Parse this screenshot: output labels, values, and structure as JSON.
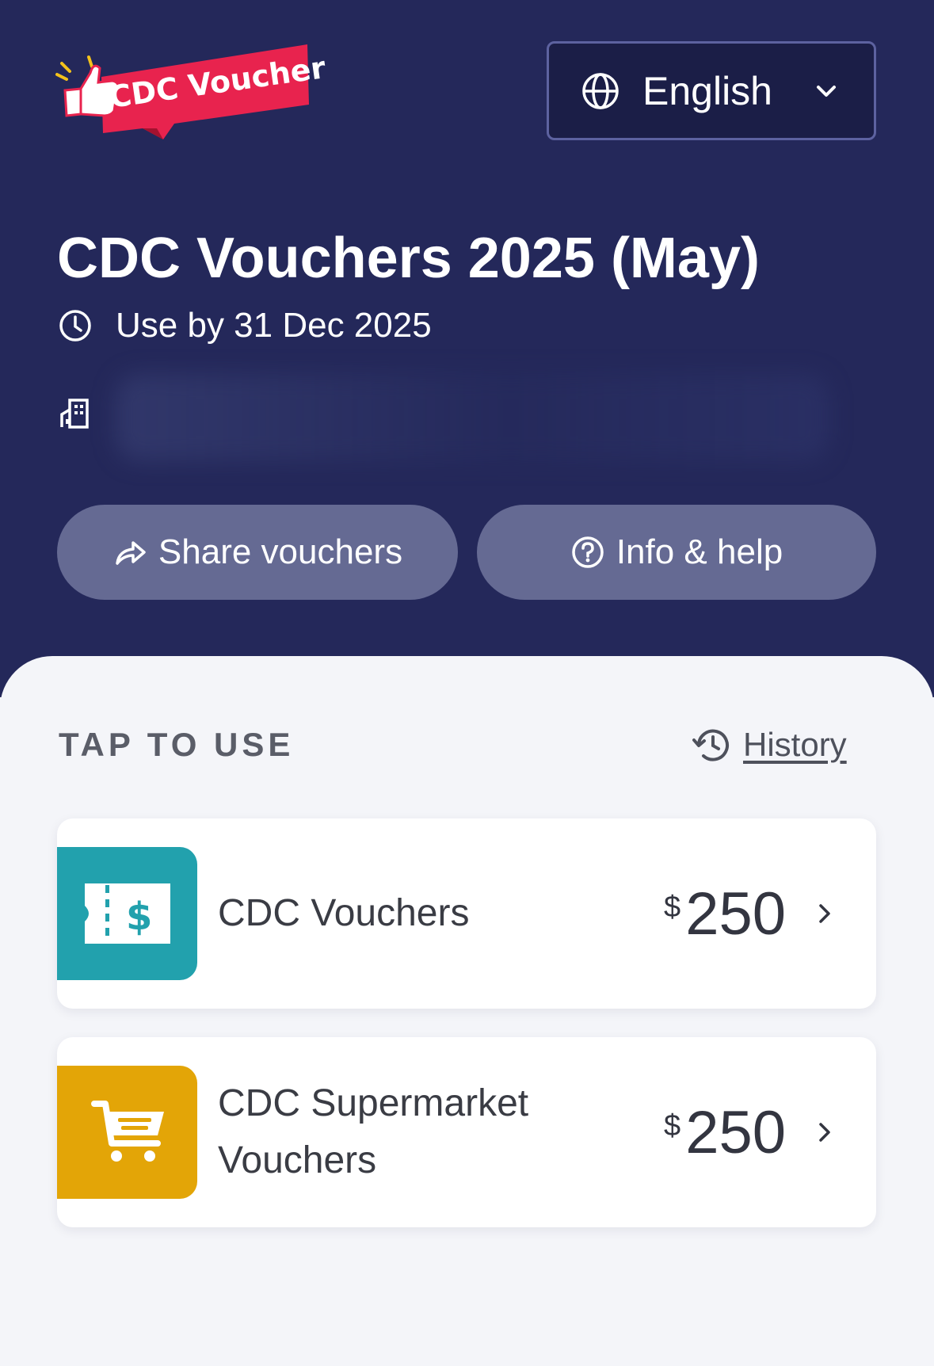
{
  "header": {
    "logo_text": "CDC Voucher",
    "language": {
      "selected": "English"
    },
    "title": "CDC Vouchers 2025 (May)",
    "expiry": "Use by 31 Dec 2025",
    "share_label": "Share vouchers",
    "info_label": "Info & help"
  },
  "main": {
    "section_label": "TAP TO USE",
    "history_label": "History",
    "vouchers": [
      {
        "name": "CDC Vouchers",
        "currency": "$",
        "amount": "250",
        "icon": "ticket-dollar-icon"
      },
      {
        "name": "CDC Supermarket Vouchers",
        "currency": "$",
        "amount": "250",
        "icon": "shopping-cart-icon"
      }
    ]
  },
  "colors": {
    "header_bg": "#24285a",
    "pill_bg": "#656a93",
    "teal": "#22a1ad",
    "gold": "#e3a507",
    "brand_red": "#e8234e"
  }
}
